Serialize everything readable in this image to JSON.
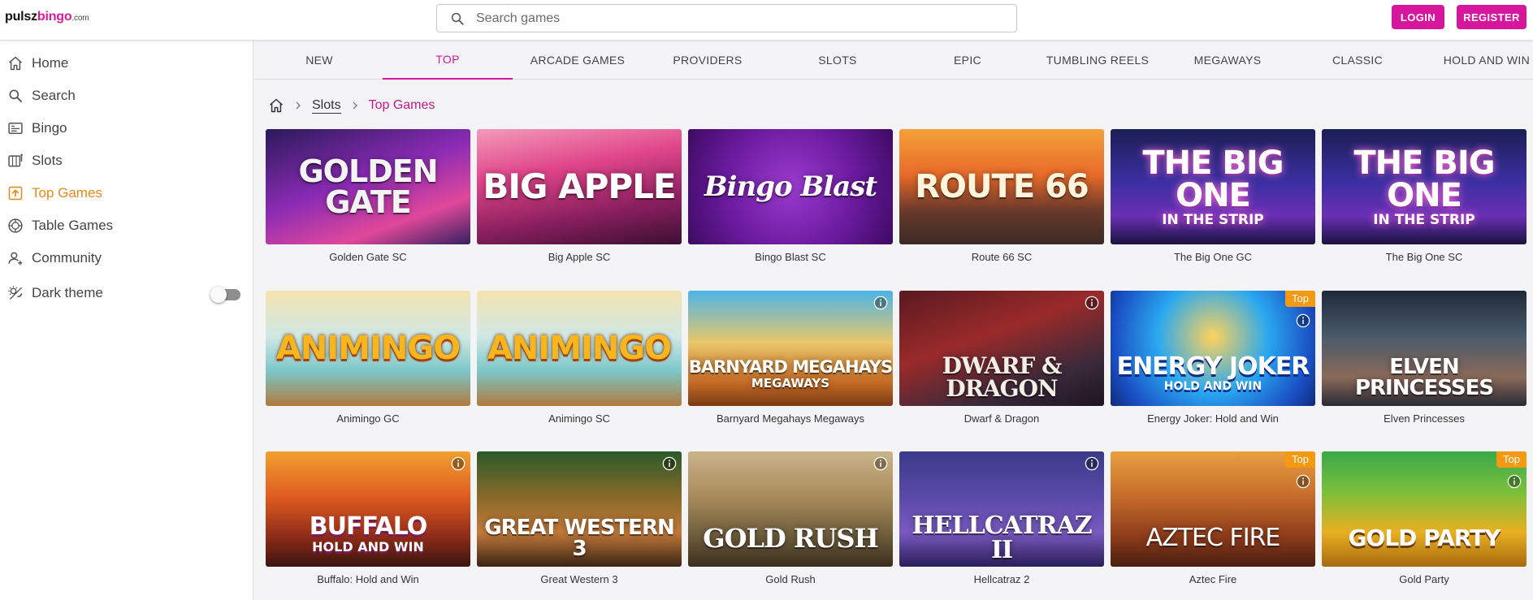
{
  "logo": {
    "part1": "pulsz",
    "part2": "bingo",
    "part3": ".com"
  },
  "search": {
    "placeholder": "Search games"
  },
  "header": {
    "login_label": "LOGIN",
    "register_label": "REGISTER"
  },
  "sidebar": {
    "items": [
      {
        "label": "Home",
        "icon": "home-icon"
      },
      {
        "label": "Search",
        "icon": "search-icon"
      },
      {
        "label": "Bingo",
        "icon": "bingo-card-icon"
      },
      {
        "label": "Slots",
        "icon": "slots-icon"
      },
      {
        "label": "Top Games",
        "icon": "top-games-icon",
        "active": true
      },
      {
        "label": "Table Games",
        "icon": "table-games-icon"
      },
      {
        "label": "Community",
        "icon": "community-icon"
      }
    ],
    "dark_theme_label": "Dark theme",
    "dark_theme_on": false
  },
  "tabs": [
    "NEW",
    "TOP",
    "ARCADE GAMES",
    "PROVIDERS",
    "SLOTS",
    "EPIC",
    "TUMBLING REELS",
    "MEGAWAYS",
    "CLASSIC",
    "HOLD AND WIN"
  ],
  "active_tab": "TOP",
  "breadcrumb": {
    "level1": "Slots",
    "current": "Top Games"
  },
  "badge_label": "Top",
  "colors": {
    "brand": "#d6179d",
    "active_nav": "#e08a1e",
    "badge": "#f39a12"
  },
  "games": [
    {
      "name": "Golden Gate SC",
      "art": "GOLDEN GATE",
      "sub": ""
    },
    {
      "name": "Big Apple SC",
      "art": "BIG APPLE",
      "sub": ""
    },
    {
      "name": "Bingo Blast SC",
      "art": "Bingo Blast",
      "sub": ""
    },
    {
      "name": "Route 66 SC",
      "art": "ROUTE 66",
      "sub": ""
    },
    {
      "name": "The Big One GC",
      "art": "THE BIG ONE",
      "sub": "IN THE STRIP"
    },
    {
      "name": "The Big One SC",
      "art": "THE BIG ONE",
      "sub": "IN THE STRIP"
    },
    {
      "name": "Animingo GC",
      "art": "ANIMINGO",
      "sub": ""
    },
    {
      "name": "Animingo SC",
      "art": "ANIMINGO",
      "sub": ""
    },
    {
      "name": "Barnyard Megahays Megaways",
      "art": "BARNYARD MEGAHAYS",
      "sub": "MEGAWAYS"
    },
    {
      "name": "Dwarf & Dragon",
      "art": "DWARF & DRAGON",
      "sub": ""
    },
    {
      "name": "Energy Joker: Hold and Win",
      "art": "ENERGY JOKER",
      "sub": "HOLD AND WIN"
    },
    {
      "name": "Elven Princesses",
      "art": "ELVEN PRINCESSES",
      "sub": ""
    },
    {
      "name": "Buffalo: Hold and Win",
      "art": "BUFFALO",
      "sub": "HOLD AND WIN"
    },
    {
      "name": "Great Western 3",
      "art": "GREAT WESTERN 3",
      "sub": ""
    },
    {
      "name": "Gold Rush",
      "art": "GOLD RUSH",
      "sub": ""
    },
    {
      "name": "Hellcatraz 2",
      "art": "HELLCATRAZ II",
      "sub": ""
    },
    {
      "name": "Aztec Fire",
      "art": "AZTEC FIRE",
      "sub": ""
    },
    {
      "name": "Gold Party",
      "art": "GOLD PARTY",
      "sub": ""
    }
  ]
}
